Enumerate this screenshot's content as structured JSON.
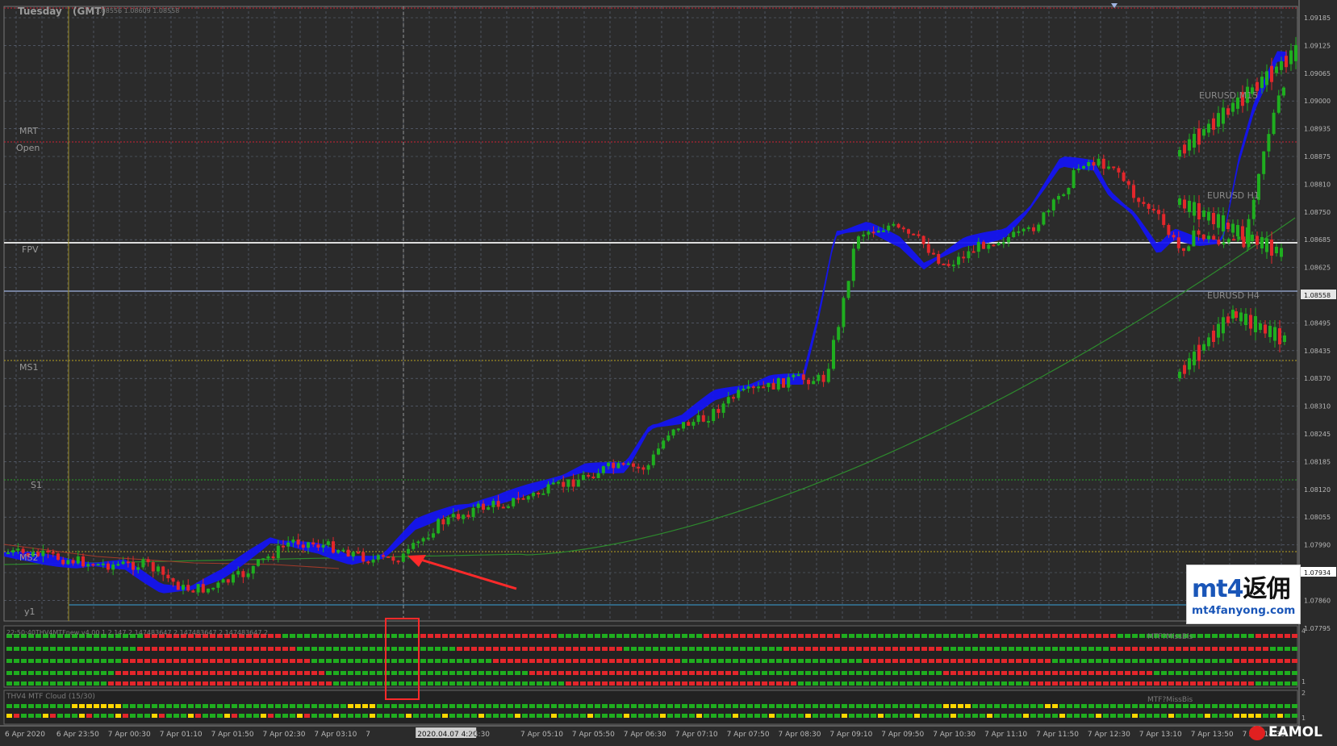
{
  "window": {
    "day_label": "Tuesday",
    "tz_label": "(GMT)",
    "quote_line": "1.08556 1.08609 1.08558"
  },
  "price_axis": {
    "ticks": [
      "1.09185",
      "1.09125",
      "1.09065",
      "1.09000",
      "1.08935",
      "1.08875",
      "1.08810",
      "1.08750",
      "1.08685",
      "1.08625",
      "1.08558",
      "1.08495",
      "1.08435",
      "1.08370",
      "1.08310",
      "1.08245",
      "1.08185",
      "1.08120",
      "1.08055",
      "1.07990",
      "1.07934",
      "1.07860",
      "1.07795"
    ],
    "current_price": "1.08558",
    "marker_price": "1.07934"
  },
  "levels": {
    "mrt": "MRT",
    "open": "Open",
    "fpv": "FPV",
    "ms1": "MS1",
    "s1": "S1",
    "ms2": "MS2",
    "y1": "y1"
  },
  "mtf_labels": {
    "m15": "EURUSD M15",
    "h1": "EURUSD H1",
    "h4": "EURUSD H4"
  },
  "indicator1": {
    "title": "22:50:40THV4MTFnew v4.00 1 2 147 2 147483647 2.147483647 2.147483647 2",
    "right_label": "MTF?MissBis",
    "scale_top": "4",
    "scale_bottom": "1"
  },
  "indicator2": {
    "title": "THV4 MTF Cloud (15/30)",
    "right_label": "MTF?MissBis",
    "scale_top": "2",
    "scale_bottom": "1"
  },
  "time_axis": {
    "ticks": [
      "6 Apr 2020",
      "6 Apr 23:50",
      "7 Apr 00:30",
      "7 Apr 01:10",
      "7 Apr 01:50",
      "7 Apr 02:30",
      "7 Apr 03:10",
      "7",
      "2020.04.07 4:20",
      "04:30",
      "7 Apr 05:10",
      "7 Apr 05:50",
      "7 Apr 06:30",
      "7 Apr 07:10",
      "7 Apr 07:50",
      "7 Apr 08:30",
      "7 Apr 09:10",
      "7 Apr 09:50",
      "7 Apr 10:30",
      "7 Apr 11:10",
      "7 Apr 11:50",
      "7 Apr 12:30",
      "7 Apr 13:10",
      "7 Apr 13:50",
      "7 Apr 14:30"
    ],
    "crosshair_label": "2020.04.07 4:20"
  },
  "watermark": {
    "main_latin": "mt4",
    "main_cn": "返佣",
    "url": "mt4fanyong.com"
  },
  "brand": "EAMOL",
  "colors": {
    "background": "#2b2b2b",
    "grid": "#7c8aa6",
    "bull": "#1fae1f",
    "bear": "#e3262b",
    "cloud": "#1414f0",
    "highlight": "#ff2a2a",
    "yellow": "#ffd700"
  }
}
